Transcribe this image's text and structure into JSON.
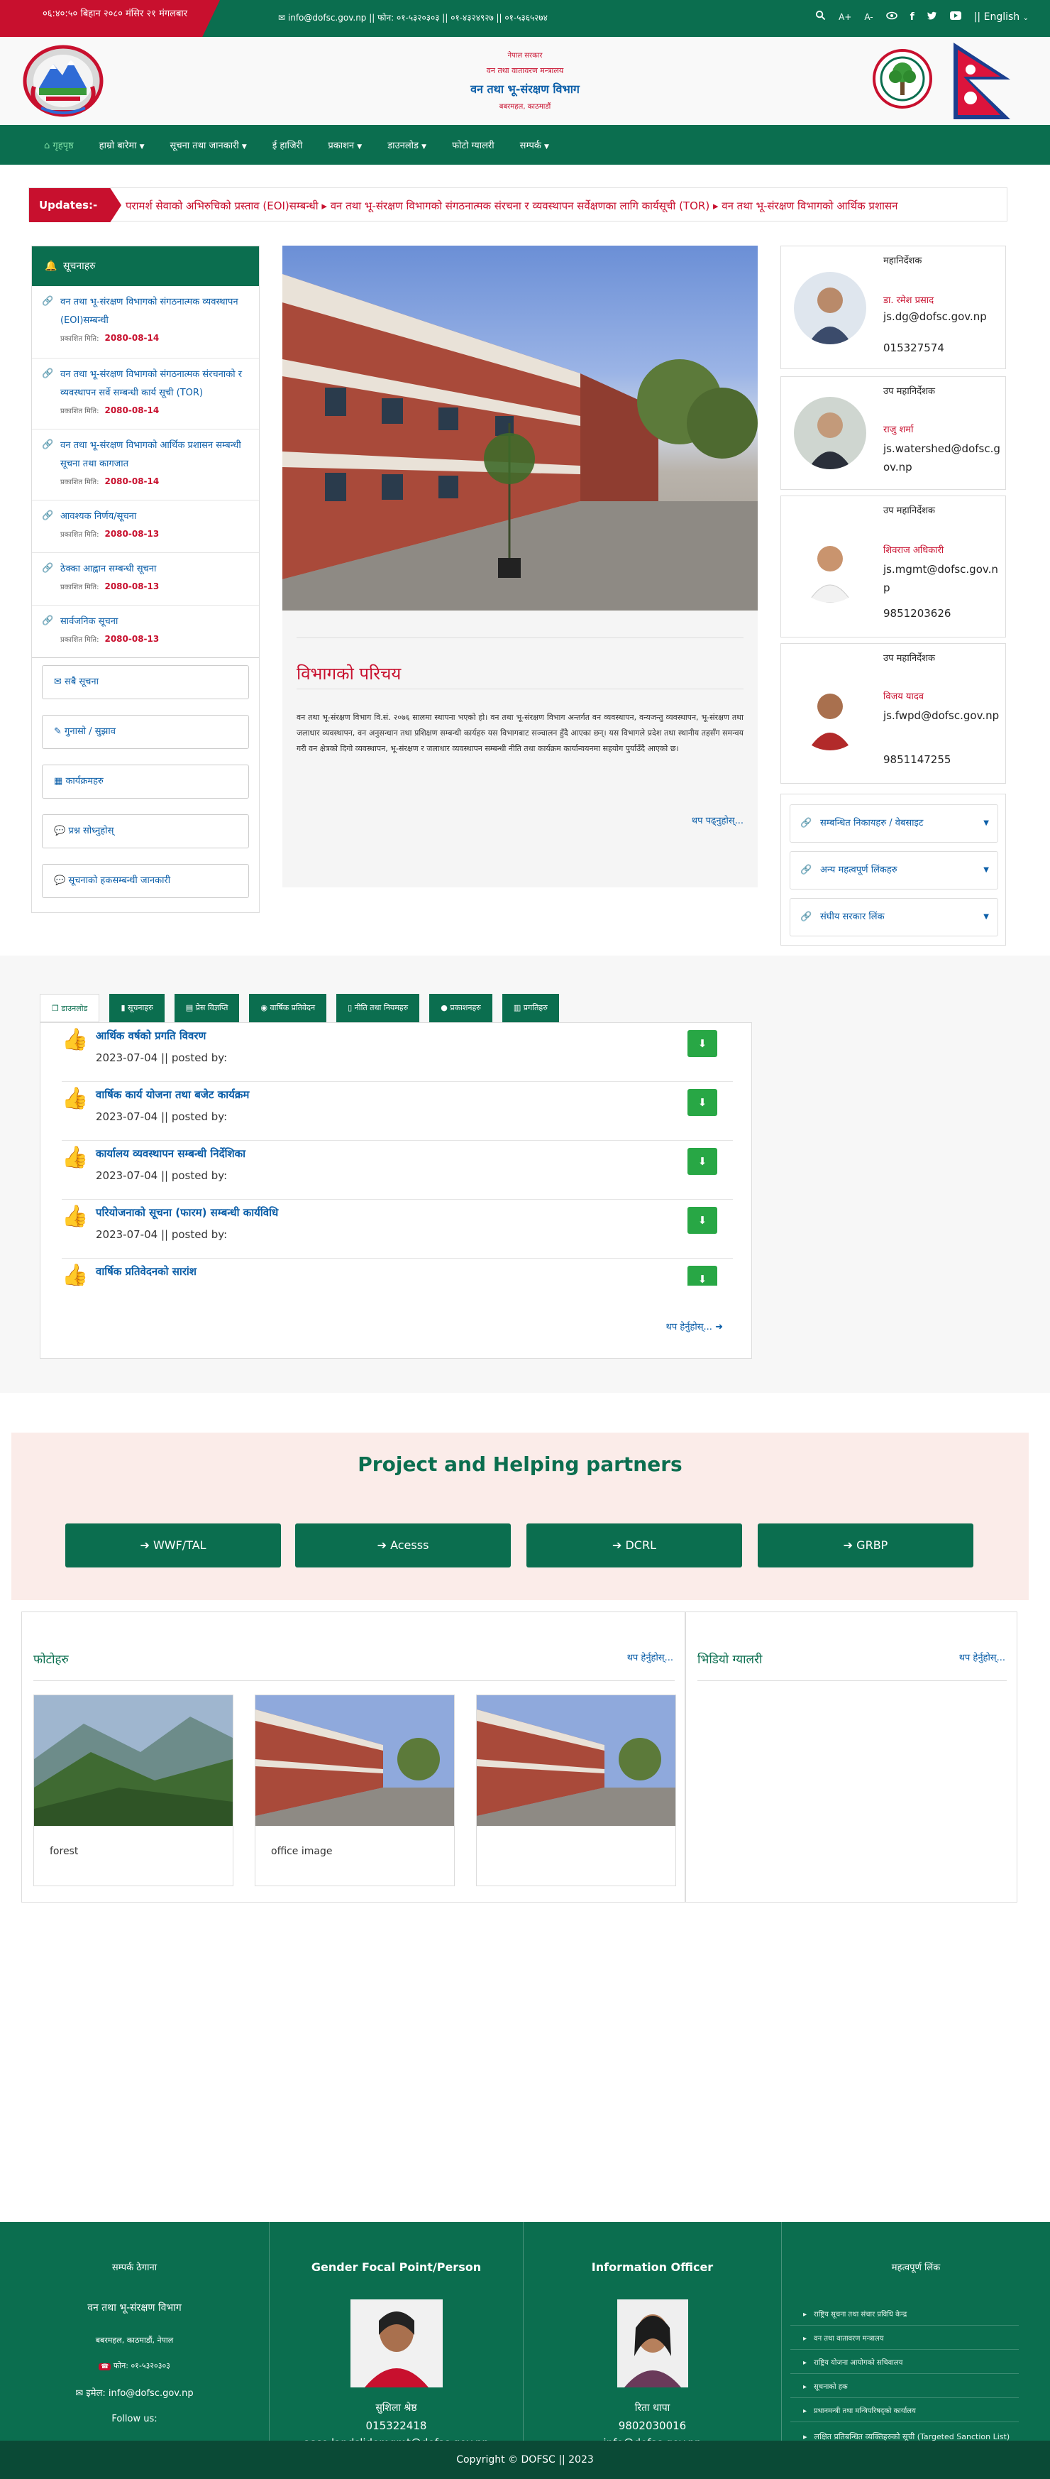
{
  "topbar": {
    "date": "०६:४०:५० बिहान   २०८० मंसिर २१ मंगलबार",
    "contact": "info@dofsc.gov.np || फोन: ०१-५३२०३०३ || ०१-४३२४९२७ || ०१-५३६५२७४",
    "language": "|| English",
    "icons": [
      "search-icon",
      "font-increase-icon",
      "font-decrease-icon",
      "eye-icon",
      "facebook-icon",
      "twitter-icon",
      "youtube-icon"
    ],
    "font_plus": "A+",
    "font_minus": "A-"
  },
  "header": {
    "line1": "नेपाल सरकार",
    "line2": "वन तथा वातावरण मन्त्रालय",
    "title": "वन तथा भू-संरक्षण विभाग",
    "address": "बबरमहल, काठमाडौं"
  },
  "nav": {
    "items": [
      "गृहपृष्ठ",
      "हाम्रो बारेमा",
      "सूचना तथा जानकारी",
      "ई हाजिरी",
      "प्रकाशन",
      "डाउनलोड",
      "फोटो ग्यालरी",
      "सम्पर्क"
    ]
  },
  "updates": {
    "label": "Updates:-",
    "text": "परामर्श सेवाको अभिरुचिको प्रस्ताव (EOI)सम्बन्धी   ▸ वन तथा भू-संरक्षण विभागको संगठनात्मक संरचना र व्यवस्थापन सर्वेक्षणका लागि कार्यसूची (TOR)   ▸ वन तथा भू-संरक्षण विभागको आर्थिक प्रशासन"
  },
  "notices": {
    "heading": "सूचनाहरु",
    "date_label": "प्रकाशित मिति:",
    "items": [
      {
        "title": "वन तथा भू-संरक्षण विभागको संगठनात्मक व्यवस्थापन (EOI)सम्बन्धी",
        "date": "2080-08-14"
      },
      {
        "title": "वन तथा भू-संरक्षण विभागको संगठनात्मक संरचनाको र व्यवस्थापन सर्वे सम्बन्धी कार्य सूची (TOR)",
        "date": "2080-08-14"
      },
      {
        "title": "वन तथा भू-संरक्षण विभागको आर्थिक प्रशासन सम्बन्धी सूचना तथा कागजात",
        "date": "2080-08-14"
      },
      {
        "title": "आवश्यक निर्णय/सूचना",
        "date": "2080-08-13"
      },
      {
        "title": "ठेक्का आह्वान सम्बन्धी सूचना",
        "date": "2080-08-13"
      },
      {
        "title": "सार्वजनिक सूचना",
        "date": "2080-08-13"
      }
    ],
    "buttons": [
      "सबै सूचना",
      "गुनासो / सुझाव",
      "कार्यक्रमहरु",
      "प्रश्न सोध्नुहोस्",
      "सूचनाको हकसम्बन्धी जानकारी"
    ]
  },
  "about": {
    "heading": "विभागको परिचय",
    "text": "वन तथा भू-संरक्षण विभाग वि.सं. २०७६ सालमा स्थापना भएको हो। वन तथा भू-संरक्षण विभाग अन्तर्गत वन व्यवस्थापन, वन्यजन्तु व्यवस्थापन, भू-संरक्षण तथा जलाधार व्यवस्थापन, वन अनुसन्धान तथा प्रशिक्षण सम्बन्धी कार्यहरु यस विभागबाट सञ्चालन हुँदै आएका छन्। यस विभागले प्रदेश तथा स्थानीय तहसँग समन्वय गरी वन क्षेत्रको दिगो व्यवस्थापन, भू-संरक्षण र जलाधार व्यवस्थापन सम्बन्धी नीति तथा कार्यक्रम कार्यान्वयनमा सहयोग पुर्याउँदै आएको छ।",
    "more": "थप पढ्नुहोस्..."
  },
  "staff": [
    {
      "role": "महानिर्देशक",
      "name": "डा. रमेश प्रसाद",
      "email": "js.dg@dofsc.gov.np",
      "phone": "015327574"
    },
    {
      "role": "उप महानिर्देशक",
      "name": "राजु शर्मा",
      "email": "js.watershed@dofsc.gov.np",
      "phone": ""
    },
    {
      "role": "उप महानिर्देशक",
      "name": "शिवराज अधिकारी",
      "email": "js.mgmt@dofsc.gov.np",
      "phone": "9851203626"
    },
    {
      "role": "उप महानिर्देशक",
      "name": "विजय यादव",
      "email": "js.fwpd@dofsc.gov.np",
      "phone": "9851147255"
    }
  ],
  "quicklinks": [
    "सम्बन्धित निकायहरु / वेबसाइट",
    "अन्य महत्वपूर्ण लिंकहरु",
    "संघीय सरकार लिंक"
  ],
  "tabs": [
    "डाउनलोड",
    "सूचनाहरु",
    "प्रेस विज्ञप्ति",
    "वार्षिक प्रतिवेदन",
    "नीति तथा नियमहरु",
    "प्रकाशनहरु",
    "प्रगतिहरु"
  ],
  "downloads": {
    "items": [
      {
        "title": "आर्थिक वर्षको प्रगति विवरण",
        "date": "2023-07-04",
        "posted": "|| posted by:"
      },
      {
        "title": "वार्षिक कार्य योजना तथा बजेट कार्यक्रम",
        "date": "2023-07-04",
        "posted": "|| posted by:"
      },
      {
        "title": "कार्यालय व्यवस्थापन सम्बन्धी निर्देशिका",
        "date": "2023-07-04",
        "posted": "|| posted by:"
      },
      {
        "title": "परियोजनाको सूचना (फारम) सम्बन्धी कार्यविधि",
        "date": "2023-07-04",
        "posted": "|| posted by:"
      },
      {
        "title": "वार्षिक प्रतिवेदनको सारांश",
        "date": "",
        "posted": ""
      }
    ],
    "more": "थप हेर्नुहोस्..."
  },
  "partners": {
    "title": "Project and Helping partners",
    "items": [
      "WWF/TAL",
      "Acesss",
      "DCRL",
      "GRBP"
    ]
  },
  "gallery": {
    "heading": "फोटोहरु",
    "more": "थप हेर्नुहोस्...",
    "items": [
      {
        "caption": "forest"
      },
      {
        "caption": "office image"
      },
      {
        "caption": ""
      }
    ]
  },
  "video": {
    "heading": "भिडियो ग्यालरी",
    "more": "थप हेर्नुहोस्..."
  },
  "footer": {
    "col1": {
      "heading": "सम्पर्क ठेगाना",
      "org": "वन तथा भू-संरक्षण विभाग",
      "address": "बबरमहल, काठमाडौं, नेपाल",
      "phone": "फोन: ०१-५३२०३०३",
      "email": "इमेल: info@dofsc.gov.np",
      "follow": "Follow us:"
    },
    "col2": {
      "heading": "Gender Focal Point/Person",
      "name": "सुशिला श्रेष्ठ",
      "phone": "015322418",
      "email": "asco.landslidemgmt@dofsc.gov.np"
    },
    "col3": {
      "heading": "Information Officer",
      "name": "रिता थापा",
      "phone": "9802030016",
      "email": "info@dofsc.gov.np"
    },
    "col4": {
      "heading": "महत्वपूर्ण लिंक",
      "links": [
        "राष्ट्रिय सूचना तथा संचार प्रविधि केन्द्र",
        "वन तथा वातावरण मन्त्रालय",
        "राष्ट्रिय योजना आयोगको सचिवालय",
        "सूचनाको हक",
        "प्रधानमन्त्री तथा मन्त्रिपरिषद्को कार्यालय",
        "लक्षित प्रतिबन्धित व्यक्तिहरुको सूची (Targeted Sanction List)"
      ]
    },
    "copyright": "Copyright © DOFSC || 2023"
  },
  "colors": {
    "primary": "#0b6e4f",
    "accent": "#c8102e",
    "link": "#0b5ea8"
  }
}
